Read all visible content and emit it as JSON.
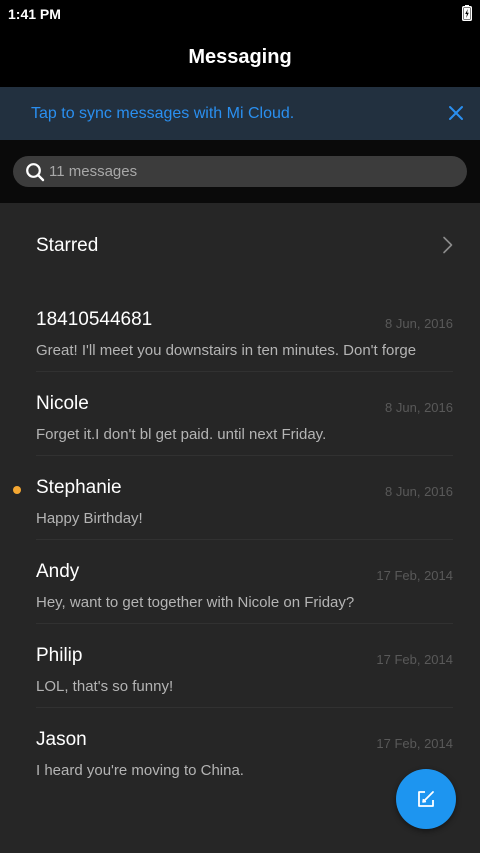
{
  "status_bar": {
    "time": "1:41 PM",
    "battery_icon": "battery-charging-icon"
  },
  "header": {
    "title": "Messaging"
  },
  "sync_banner": {
    "text": "Tap to sync messages with Mi Cloud.",
    "close_icon": "close-icon"
  },
  "search": {
    "placeholder": "11 messages",
    "icon": "search-icon"
  },
  "starred": {
    "label": "Starred",
    "icon": "chevron-right-icon"
  },
  "threads": [
    {
      "name": "18410544681",
      "date": "8 Jun, 2016",
      "preview": "Great! I'll meet you downstairs in ten minutes. Don't forge",
      "unread": false
    },
    {
      "name": "Nicole",
      "date": "8 Jun, 2016",
      "preview": "Forget it.I don't bl get paid. until next Friday.",
      "unread": false
    },
    {
      "name": "Stephanie",
      "date": "8 Jun, 2016",
      "preview": "Happy Birthday!",
      "unread": true
    },
    {
      "name": "Andy",
      "date": "17 Feb, 2014",
      "preview": "Hey, want to get together with Nicole on Friday?",
      "unread": false
    },
    {
      "name": "Philip",
      "date": "17 Feb, 2014",
      "preview": "LOL, that's so funny!",
      "unread": false
    },
    {
      "name": "Jason",
      "date": "17 Feb, 2014",
      "preview": "I heard you're moving to China.",
      "unread": false
    }
  ],
  "compose": {
    "icon": "compose-icon"
  },
  "colors": {
    "accent": "#1d95f0",
    "banner_text": "#2a8ff0",
    "unread_dot": "#f4a732",
    "list_background": "#262626"
  }
}
